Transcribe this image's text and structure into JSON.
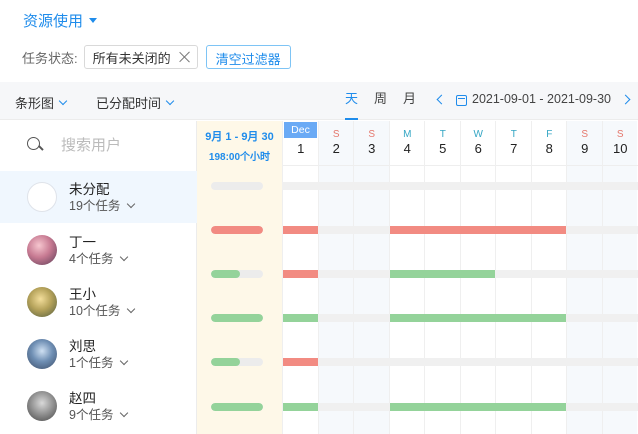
{
  "header": {
    "title": "资源使用"
  },
  "filters": {
    "label": "任务状态:",
    "tag": "所有未关闭的",
    "clear_label": "清空过滤器"
  },
  "toolbar": {
    "chart_type": "条形图",
    "time_field": "已分配时间",
    "views": [
      {
        "label": "天",
        "active": true
      },
      {
        "label": "周",
        "active": false
      },
      {
        "label": "月",
        "active": false
      }
    ],
    "date_range": "2021-09-01 - 2021-09-30"
  },
  "search": {
    "placeholder": "搜索用户"
  },
  "summary": {
    "range": "9月 1 - 9月 30",
    "hours": "198:00个小时"
  },
  "colors": {
    "accent": "#1f8ceb",
    "red": "#f28b82",
    "green": "#94d39a",
    "track": "#ececec"
  },
  "users": [
    {
      "name": "未分配",
      "count": "19个任务",
      "avatar": "placeholder-avatar",
      "summary_fill": 0,
      "selected": true
    },
    {
      "name": "丁一",
      "count": "4个任务",
      "avatar": "photo-avatar-pink",
      "summary_fill": 1.0,
      "summary_color": "red"
    },
    {
      "name": "王小",
      "count": "10个任务",
      "avatar": "photo-avatar-yellow",
      "summary_fill": 0.55,
      "summary_color": "green"
    },
    {
      "name": "刘思",
      "count": "1个任务",
      "avatar": "photo-avatar-blue",
      "summary_fill": 1.0,
      "summary_color": "green"
    },
    {
      "name": "刘思",
      "count": "1个任务",
      "avatar": "photo-avatar-blue",
      "summary_fill": 0.55,
      "summary_color": "green",
      "hidden": true
    },
    {
      "name": "赵四",
      "count": "9个任务",
      "avatar": "photo-avatar-gray",
      "summary_fill": 1.0,
      "summary_color": "green"
    }
  ],
  "days": [
    {
      "letter": "",
      "num": "1",
      "month": "Dec"
    },
    {
      "letter": "S",
      "num": "2",
      "weekend": true
    },
    {
      "letter": "S",
      "num": "3",
      "weekend": true
    },
    {
      "letter": "M",
      "num": "4"
    },
    {
      "letter": "T",
      "num": "5"
    },
    {
      "letter": "W",
      "num": "6"
    },
    {
      "letter": "T",
      "num": "7"
    },
    {
      "letter": "F",
      "num": "8"
    },
    {
      "letter": "S",
      "num": "9",
      "weekend": true
    },
    {
      "letter": "S",
      "num": "10",
      "weekend": true
    }
  ],
  "timeline_rows": [
    {
      "bars": []
    },
    {
      "bars": [
        {
          "start": 0,
          "span": 1,
          "color": "red"
        },
        {
          "start": 3,
          "span": 5,
          "color": "red"
        }
      ]
    },
    {
      "bars": [
        {
          "start": 0,
          "span": 1,
          "color": "red"
        },
        {
          "start": 3,
          "span": 3,
          "color": "green"
        }
      ]
    },
    {
      "bars": [
        {
          "start": 0,
          "span": 1,
          "color": "green"
        },
        {
          "start": 3,
          "span": 5,
          "color": "green"
        }
      ]
    },
    {
      "bars": [
        {
          "start": 0,
          "span": 1,
          "color": "red"
        }
      ]
    },
    {
      "bars": [
        {
          "start": 0,
          "span": 1,
          "color": "green"
        },
        {
          "start": 3,
          "span": 5,
          "color": "green"
        }
      ]
    }
  ]
}
